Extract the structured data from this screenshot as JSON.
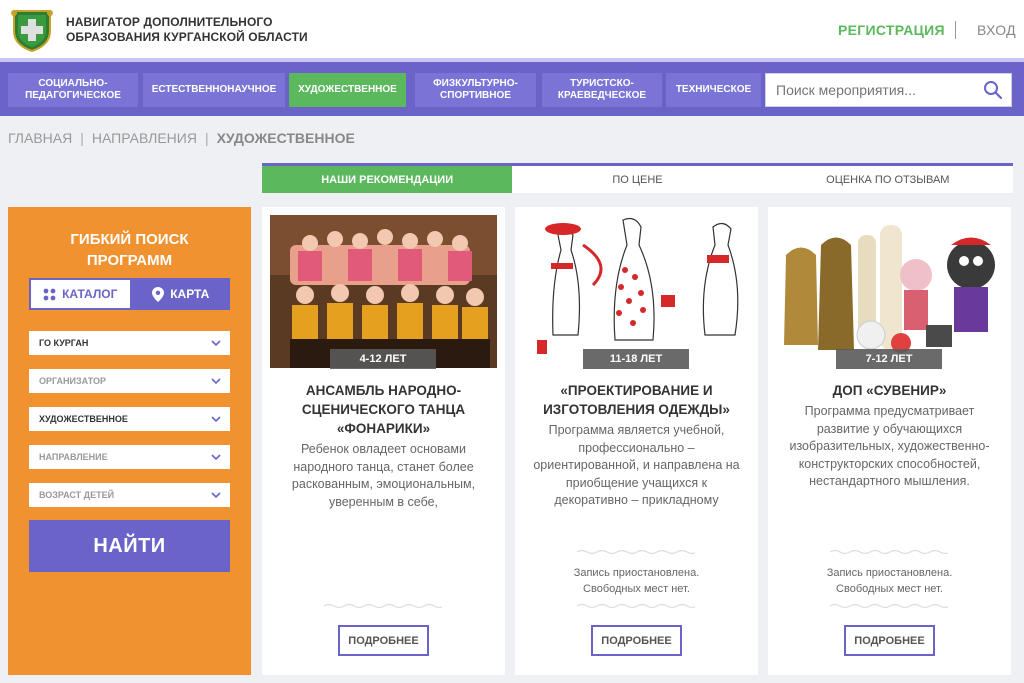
{
  "header": {
    "site_title": "НАВИГАТОР ДОПОЛНИТЕЛЬНОГО\nОБРАЗОВАНИЯ КУРГАНСКОЙ ОБЛАСТИ",
    "register_label": "РЕГИСТРАЦИЯ",
    "login_label": "ВХОД"
  },
  "nav": {
    "items": [
      {
        "label": "СОЦИАЛЬНО-\nПЕДАГОГИЧЕСКОЕ"
      },
      {
        "label": "ЕСТЕСТВЕННОНАУЧНОЕ"
      },
      {
        "label": "ХУДОЖЕСТВЕННОЕ"
      },
      {
        "label": "ФИЗКУЛЬТУРНО-\nСПОРТИВНОЕ"
      },
      {
        "label": "ТУРИСТСКО-\nКРАЕВЕДЧЕСКОЕ"
      },
      {
        "label": "ТЕХНИЧЕСКОЕ"
      }
    ],
    "active_index": 2,
    "search_placeholder": "Поиск мероприятия..."
  },
  "breadcrumb": {
    "home": "ГЛАВНАЯ",
    "directions": "НАПРАВЛЕНИЯ",
    "current": "ХУДОЖЕСТВЕННОЕ"
  },
  "sort_tabs": [
    {
      "label": "НАШИ РЕКОМЕНДАЦИИ"
    },
    {
      "label": "ПО ЦЕНЕ"
    },
    {
      "label": "ОЦЕНКА ПО ОТЗЫВАМ"
    }
  ],
  "filter": {
    "title": "ГИБКИЙ ПОИСК\nПРОГРАММ",
    "catalog_label": "КАТАЛОГ",
    "map_label": "КАРТА",
    "selects": [
      {
        "value": "ГО КУРГАН"
      },
      {
        "value": "ОРГАНИЗАТОР"
      },
      {
        "value": "ХУДОЖЕСТВЕННОЕ"
      },
      {
        "value": "НАПРАВЛЕНИЕ"
      },
      {
        "value": "ВОЗРАСТ ДЕТЕЙ"
      }
    ],
    "find_label": "НАЙТИ"
  },
  "cards": [
    {
      "age": "4-12 ЛЕТ",
      "title": "АНСАМБЛЬ НАРОДНО-\nСЦЕНИЧЕСКОГО ТАНЦА\n«ФОНАРИКИ»",
      "description": "Ребенок овладеет основами\nнародного танца, станет более\nраскованным, эмоциональным,\nуверенным в себе,",
      "status": "",
      "more_label": "ПОДРОБНЕЕ"
    },
    {
      "age": "11-18 ЛЕТ",
      "title": "«ПРОЕКТИРОВАНИЕ И\nИЗГОТОВЛЕНИЯ ОДЕЖДЫ»",
      "description": "Программа является учебной,\nпрофессионально –\nориентированной, и направлена на\nприобщение учащихся к\nдекоративно – прикладному",
      "status": "Запись приостановлена.\nСвободных мест нет.",
      "more_label": "ПОДРОБНЕЕ"
    },
    {
      "age": "7-12 ЛЕТ",
      "title": "ДОП «СУВЕНИР»",
      "description": "Программа предусматривает\nразвитие у обучающихся\nизобразительных, художественно-\nконструкторских способностей,\nнестандартного мышления.",
      "status": "Запись приостановлена.\nСвободных мест нет.",
      "more_label": "ПОДРОБНЕЕ"
    }
  ],
  "colors": {
    "primary": "#6a64c8",
    "accent_green": "#5cb85c",
    "filter_orange": "#f0922f"
  }
}
